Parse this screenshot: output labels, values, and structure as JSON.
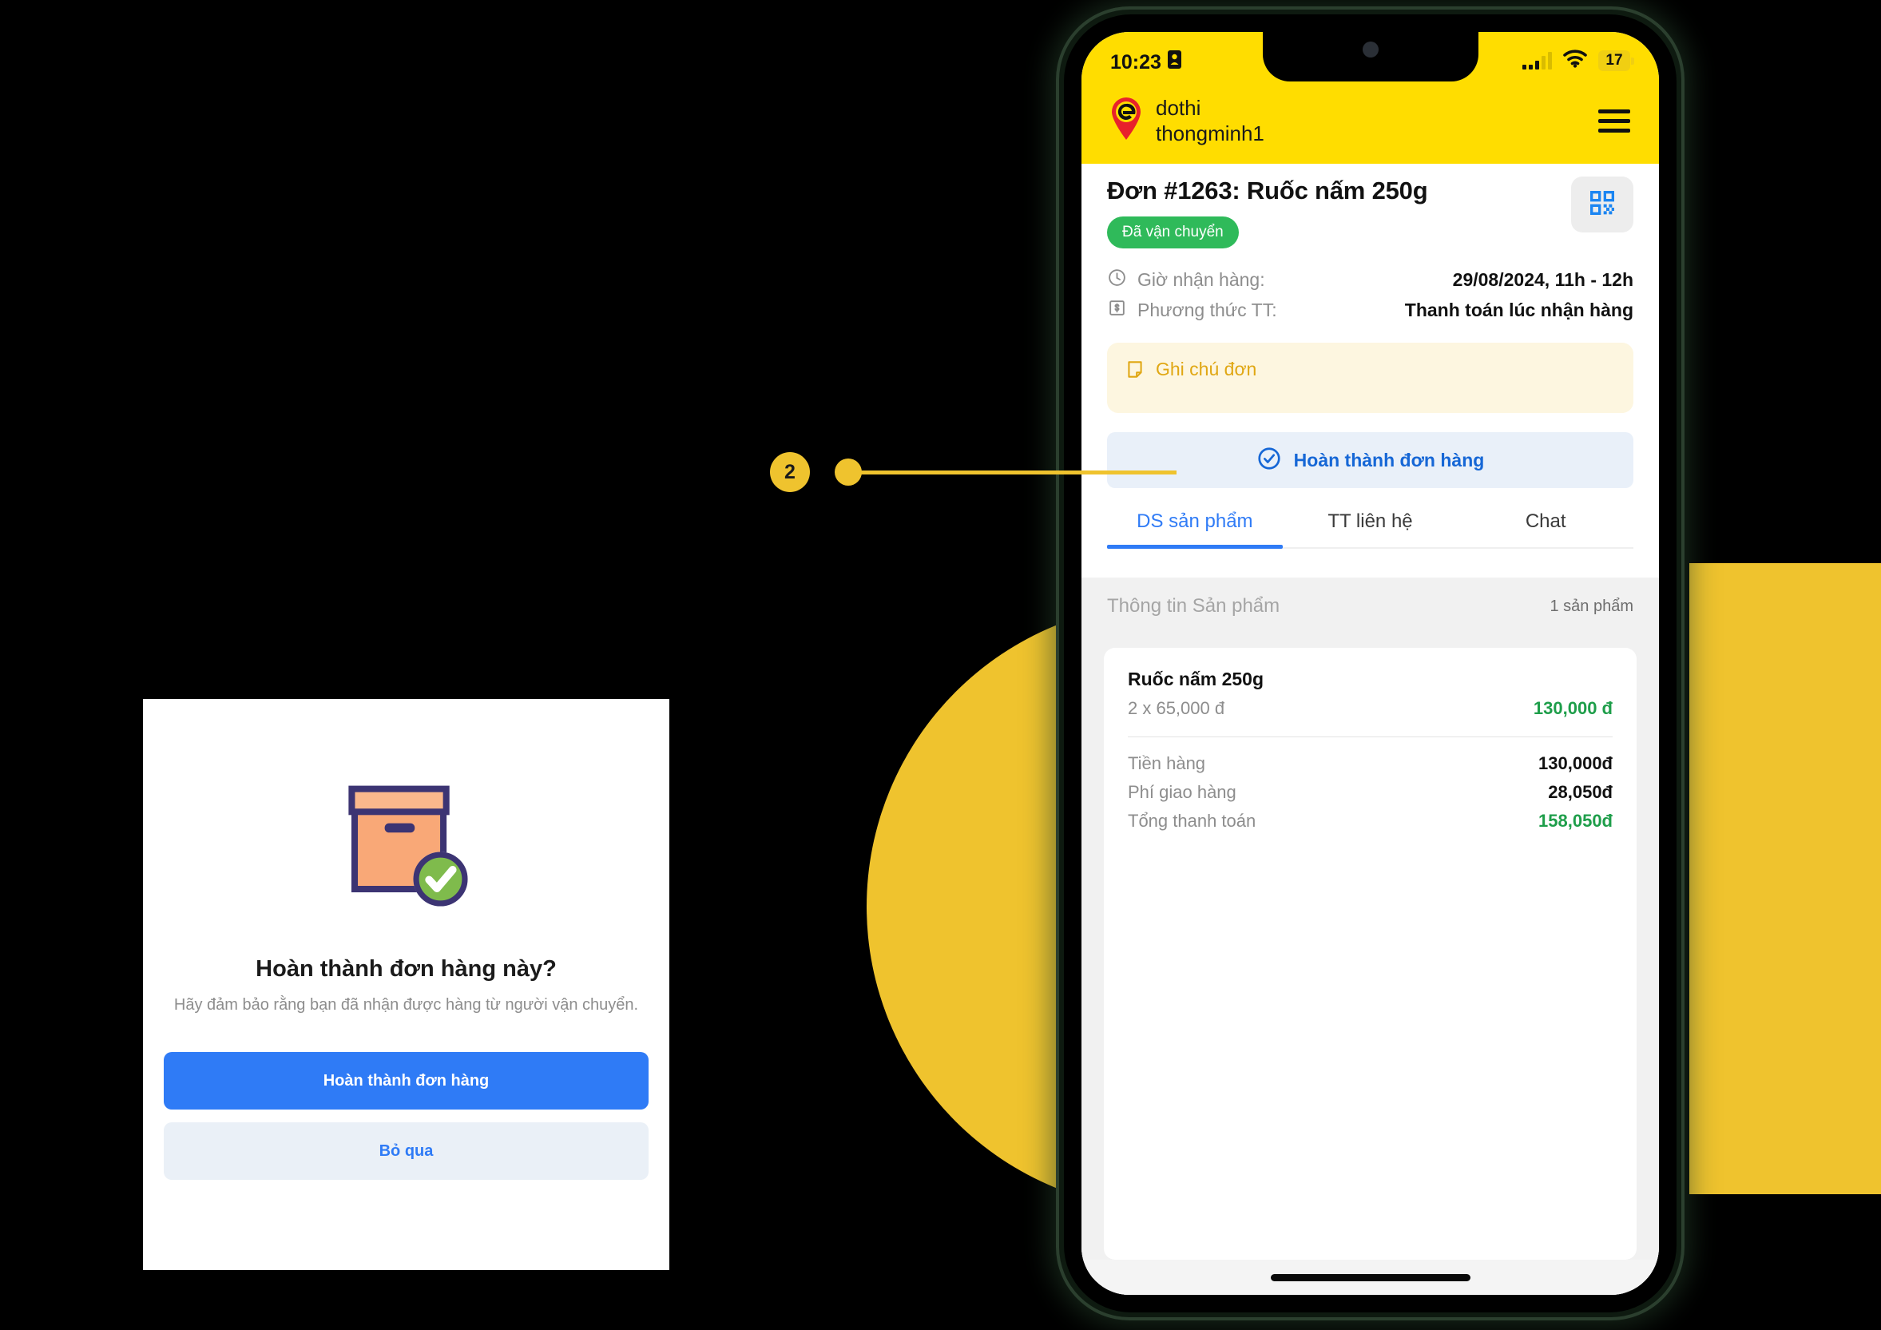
{
  "callout": {
    "number": "2"
  },
  "dialog": {
    "illustration_icon": "package-check-icon",
    "title": "Hoàn thành đơn hàng này?",
    "subtitle": "Hãy đảm bảo rằng bạn đã nhận được hàng từ người vận chuyển.",
    "primary_button": "Hoàn thành đơn hàng",
    "secondary_button": "Bỏ qua"
  },
  "phone": {
    "status_bar": {
      "time": "10:23",
      "recording_icon": "screen-record-icon",
      "signal_icon": "signal-bars-icon",
      "wifi_icon": "wifi-icon",
      "battery_level": "17"
    },
    "header": {
      "logo_icon": "map-pin-logo-icon",
      "brand_line1": "dothi",
      "brand_line2": "thongminh1",
      "menu_icon": "hamburger-menu-icon"
    },
    "order": {
      "title": "Đơn #1263: Ruốc nấm 250g",
      "status": "Đã vận chuyển",
      "qr_icon": "qr-code-icon",
      "meta": [
        {
          "icon": "clock-icon",
          "label": "Giờ nhận hàng:",
          "value": "29/08/2024, 11h - 12h"
        },
        {
          "icon": "money-bill-icon",
          "label": "Phương thức TT:",
          "value": "Thanh toán lúc nhận hàng"
        }
      ],
      "note": {
        "icon": "note-icon",
        "label": "Ghi chú đơn",
        "value": ""
      },
      "complete_action": {
        "icon": "check-circle-icon",
        "label": "Hoàn thành đơn hàng"
      }
    },
    "tabs": [
      {
        "label": "DS sản phẩm",
        "active": true
      },
      {
        "label": "TT liên hệ",
        "active": false
      },
      {
        "label": "Chat",
        "active": false
      }
    ],
    "product_section": {
      "title": "Thông tin Sản phẩm",
      "count": "1 sản phẩm",
      "product": {
        "name": "Ruốc nấm 250g",
        "quantity_price": "2 x 65,000 đ",
        "amount": "130,000 đ"
      },
      "summary": [
        {
          "label": "Tiền hàng",
          "value": "130,000đ",
          "green": false
        },
        {
          "label": "Phí giao hàng",
          "value": "28,050đ",
          "green": false
        },
        {
          "label": "Tổng thanh toán",
          "value": "158,050đ",
          "green": true
        }
      ]
    }
  },
  "colors": {
    "brand_yellow": "#FFDD00",
    "accent_yellow": "#EFC32E",
    "primary_blue": "#2F7BF6",
    "link_blue": "#1667D6",
    "success_green": "#2FBA5A",
    "amount_green": "#1E9E4A",
    "note_bg": "#FDF6E0"
  }
}
